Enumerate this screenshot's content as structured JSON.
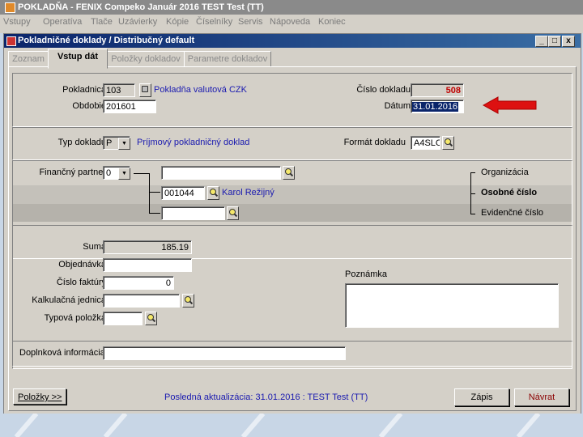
{
  "app": {
    "title": "POKLADŇA - FENIX Compeko  Január 2016  TEST Test  (TT)",
    "menu": [
      "Vstupy",
      "Operatíva",
      "Tlače",
      "Uzávierky",
      "Kópie",
      "Číselníky",
      "Servis",
      "Nápoveda",
      "Koniec"
    ]
  },
  "window": {
    "title": "Pokladničné doklady / Distribučný default",
    "min": "_",
    "max": "□",
    "close": "x"
  },
  "tabs": [
    "Zoznam",
    "Vstup dát",
    "Položky dokladov",
    "Parametre dokladov"
  ],
  "header": {
    "pokladnica_label": "Pokladnica",
    "pokladnica_value": "103",
    "pokladnica_name": "Pokladňa valutová CZK",
    "obdobie_label": "Obdobie",
    "obdobie_value": "201601",
    "cislo_label": "Číslo dokladu",
    "cislo_value": "508",
    "datum_label": "Dátum",
    "datum_value": "31.01.2016"
  },
  "typ": {
    "typ_label": "Typ dokladu",
    "typ_value": "P",
    "typ_name": "Príjmový pokladničný doklad",
    "format_label": "Formát dokladu",
    "format_value": "A4SLO"
  },
  "partner": {
    "label": "Finančný partner",
    "select_value": "0",
    "row1_value": "",
    "row2_value": "001044",
    "row2_name": "Karol Režijný",
    "row3_value": "",
    "opt_org": "Organizácia",
    "opt_os": "Osobné číslo",
    "opt_ev": "Evidenčné číslo"
  },
  "details": {
    "suma_label": "Suma",
    "suma_value": "185.19",
    "objednavka_label": "Objednávka",
    "objednavka_value": "",
    "faktura_label": "Číslo faktúry",
    "faktura_value": "0",
    "kalk_label": "Kalkulačná jednica",
    "kalk_value": "",
    "typova_label": "Typová položka",
    "typova_value": "",
    "poznamka_label": "Poznámka",
    "poznamka_value": ""
  },
  "doplnkova": {
    "label": "Doplnková informácia",
    "value": ""
  },
  "footer": {
    "polozky_button": "Položky >>",
    "status": "Posledná aktualizácia: 31.01.2016 : TEST Test  (TT)",
    "zapis_button": "Zápis",
    "navrat_button": "Návrat"
  },
  "colors": {
    "doc_number": "#c00000",
    "arrow": "#dd1111",
    "link_text": "#1a1ab0",
    "title_bar": "#0a246a"
  },
  "icons": {
    "search": "magnifier-icon",
    "pokladnica": "cash-register-icon",
    "arrow": "red-left-arrow-icon"
  }
}
